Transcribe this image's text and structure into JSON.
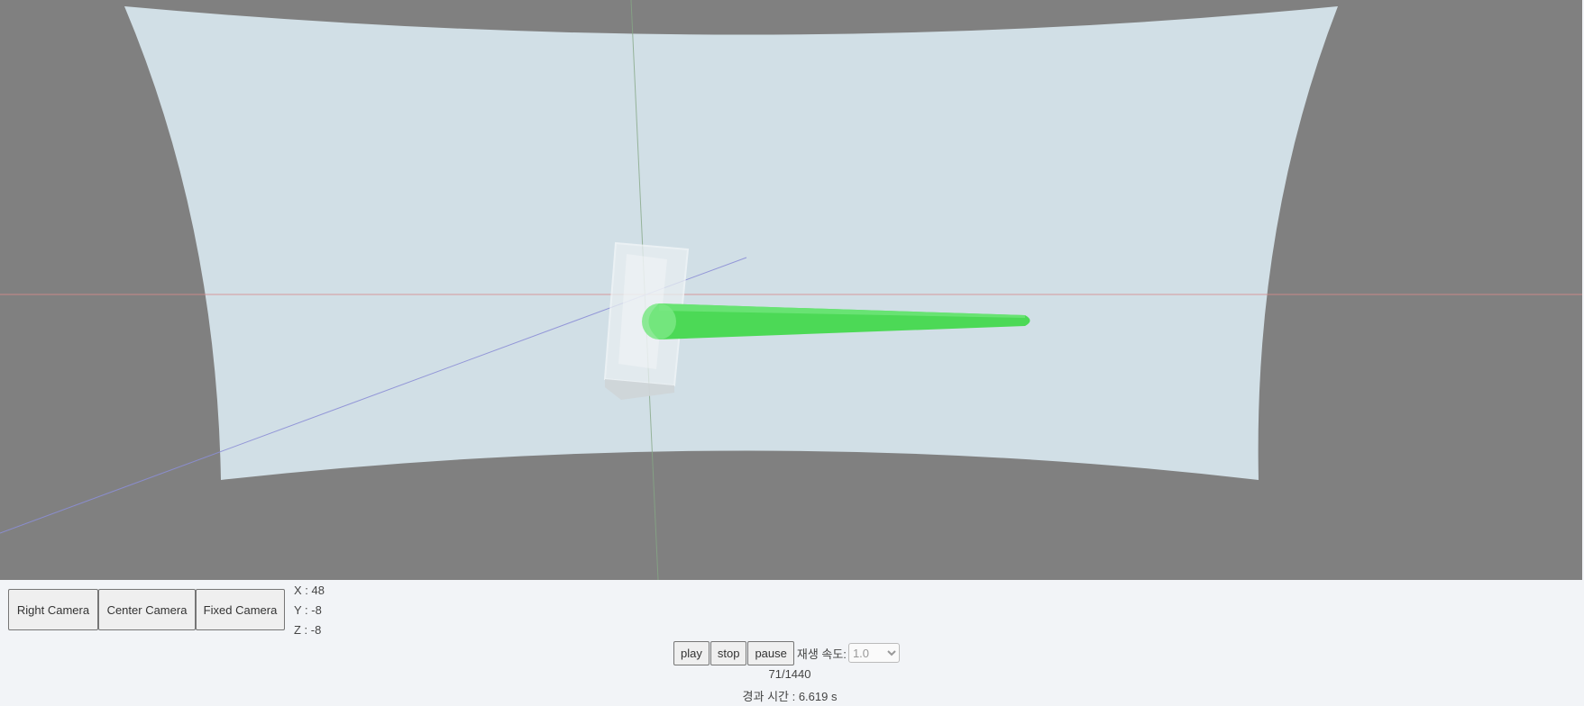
{
  "colors": {
    "viewport_background": "#808080",
    "screen_surface": "#d1dfe6",
    "tube_green": "#4cd956",
    "x_axis": "#d98080",
    "y_axis": "#86a886",
    "z_axis": "#8c8fd6",
    "panel_background": "#f2f4f7"
  },
  "camera_buttons": {
    "right": "Right Camera",
    "center": "Center Camera",
    "fixed": "Fixed Camera"
  },
  "coordinates": {
    "x": "X : 48",
    "y": "Y : -8",
    "z": "Z : -8"
  },
  "playback": {
    "play": "play",
    "stop": "stop",
    "pause": "pause",
    "speed_label": "재생 속도:",
    "speed_options": [
      "1.0"
    ],
    "speed_selected": "1.0"
  },
  "frame_counter": "71/1440",
  "elapsed_time": "경과 시간 : 6.619 s"
}
